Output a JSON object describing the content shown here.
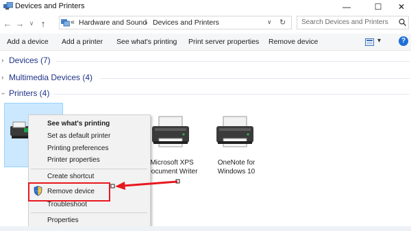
{
  "window": {
    "title": "Devices and Printers",
    "minimize": "—",
    "maximize": "☐",
    "close": "✕"
  },
  "address": {
    "crumb_sep": "«",
    "part1": "Hardware and Sound",
    "sep": "›",
    "part2": "Devices and Printers",
    "dropdown": "∨",
    "refresh": "↻"
  },
  "search": {
    "placeholder": "Search Devices and Printers"
  },
  "nav": {
    "back": "←",
    "forward": "→",
    "down": "∨",
    "up": "↑"
  },
  "toolbar": {
    "add_device": "Add a device",
    "add_printer": "Add a printer",
    "see_printing": "See what's printing",
    "print_server": "Print server properties",
    "remove_device": "Remove device",
    "view_dropdown": "▾",
    "help": "?"
  },
  "groups": {
    "devices": "Devices (7)",
    "multimedia": "Multimedia Devices (4)",
    "printers": "Printers (4)"
  },
  "printers": {
    "xps_line1": "Microsoft XPS",
    "xps_line2": "Document Writer",
    "onenote_line1": "OneNote for",
    "onenote_line2": "Windows 10"
  },
  "context_menu": {
    "see_printing": "See what's printing",
    "set_default": "Set as default printer",
    "printing_prefs": "Printing preferences",
    "printer_props": "Printer properties",
    "create_shortcut": "Create shortcut",
    "remove_device": "Remove device",
    "troubleshoot": "Troubleshoot",
    "properties": "Properties"
  },
  "colors": {
    "accent": "#1e3287",
    "selection": "#cce8ff",
    "highlight": "#e8171e",
    "help": "#1f6fd6"
  }
}
